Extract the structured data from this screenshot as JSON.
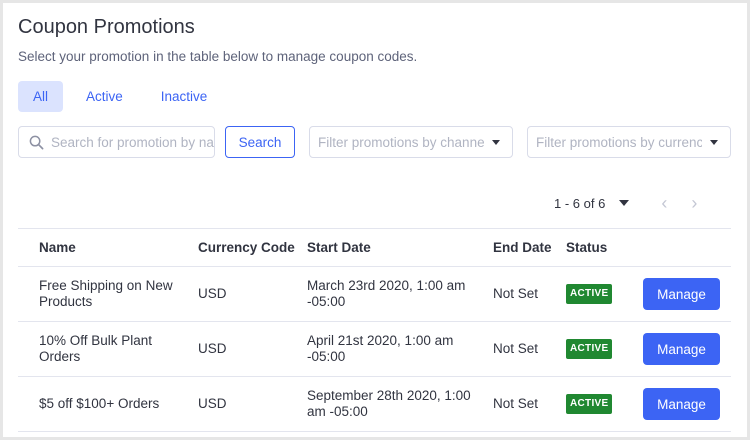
{
  "page": {
    "title": "Coupon Promotions",
    "subtitle": "Select your promotion in the table below to manage coupon codes."
  },
  "tabs": [
    {
      "label": "All",
      "active": true
    },
    {
      "label": "Active",
      "active": false
    },
    {
      "label": "Inactive",
      "active": false
    }
  ],
  "filters": {
    "search_placeholder": "Search for promotion by name",
    "search_button": "Search",
    "channel_placeholder": "Filter promotions by channel",
    "currency_placeholder": "Filter promotions by currency"
  },
  "pagination": {
    "range_text": "1 - 6 of 6",
    "prev_icon": "‹",
    "next_icon": "›"
  },
  "table": {
    "columns": [
      "Name",
      "Currency Code",
      "Start Date",
      "End Date",
      "Status",
      ""
    ],
    "rows": [
      {
        "name": "Free Shipping on New Products",
        "currency": "USD",
        "start": "March 23rd 2020, 1:00 am -05:00",
        "end": "Not Set",
        "status": "ACTIVE",
        "action": "Manage"
      },
      {
        "name": "10% Off Bulk Plant Orders",
        "currency": "USD",
        "start": "April 21st 2020, 1:00 am -05:00",
        "end": "Not Set",
        "status": "ACTIVE",
        "action": "Manage"
      },
      {
        "name": "$5 off $100+ Orders",
        "currency": "USD",
        "start": "September 28th 2020, 1:00 am -05:00",
        "end": "Not Set",
        "status": "ACTIVE",
        "action": "Manage"
      }
    ]
  },
  "colors": {
    "accent": "#3c64f4",
    "tab_active_bg": "#dbe3fe",
    "status_active": "#208831"
  },
  "icons": {
    "search": "search-icon",
    "dropdown": "chevron-down-icon",
    "prev": "chevron-left-icon",
    "next": "chevron-right-icon"
  }
}
